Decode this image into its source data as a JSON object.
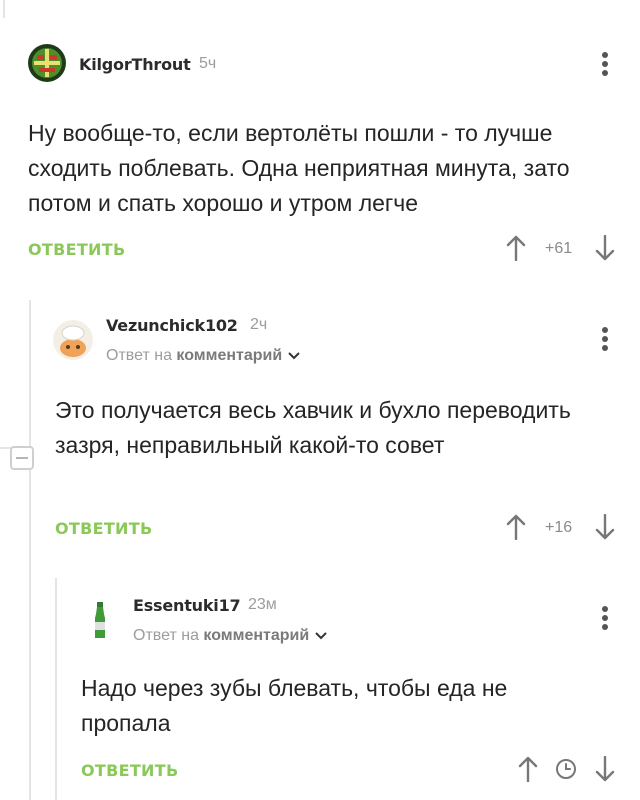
{
  "comments": [
    {
      "username": "KilgorThrout",
      "time": "5ч",
      "text": "Ну вообще-то, если вертолёты пошли - то лучше сходить поблевать. Одна неприятная минута, зато потом и спать хорошо и утром легче",
      "reply_label": "ОТВЕТИТЬ",
      "score": "+61"
    },
    {
      "username": "Vezunchick102",
      "time": "2ч",
      "reply_to_prefix": "Ответ на",
      "reply_to_link": "комментарий",
      "text": "Это получается весь хавчик и бухло переводить зазря, неправильный какой-то совет",
      "reply_label": "ОТВЕТИТЬ",
      "score": "+16"
    },
    {
      "username": "Essentuki17",
      "time": "23м",
      "reply_to_prefix": "Ответ на",
      "reply_to_link": "комментарий",
      "text": "Надо через зубы блевать, чтобы еда не пропала",
      "reply_label": "ОТВЕТИТЬ"
    }
  ],
  "colors": {
    "reply": "#8ac858",
    "thread_line": "#e4e4e4",
    "meta": "#9c9c9c"
  },
  "icons": [
    "kebab-menu-icon",
    "arrow-up-icon",
    "arrow-down-icon",
    "clock-icon",
    "chevron-down-icon",
    "collapse-icon"
  ]
}
